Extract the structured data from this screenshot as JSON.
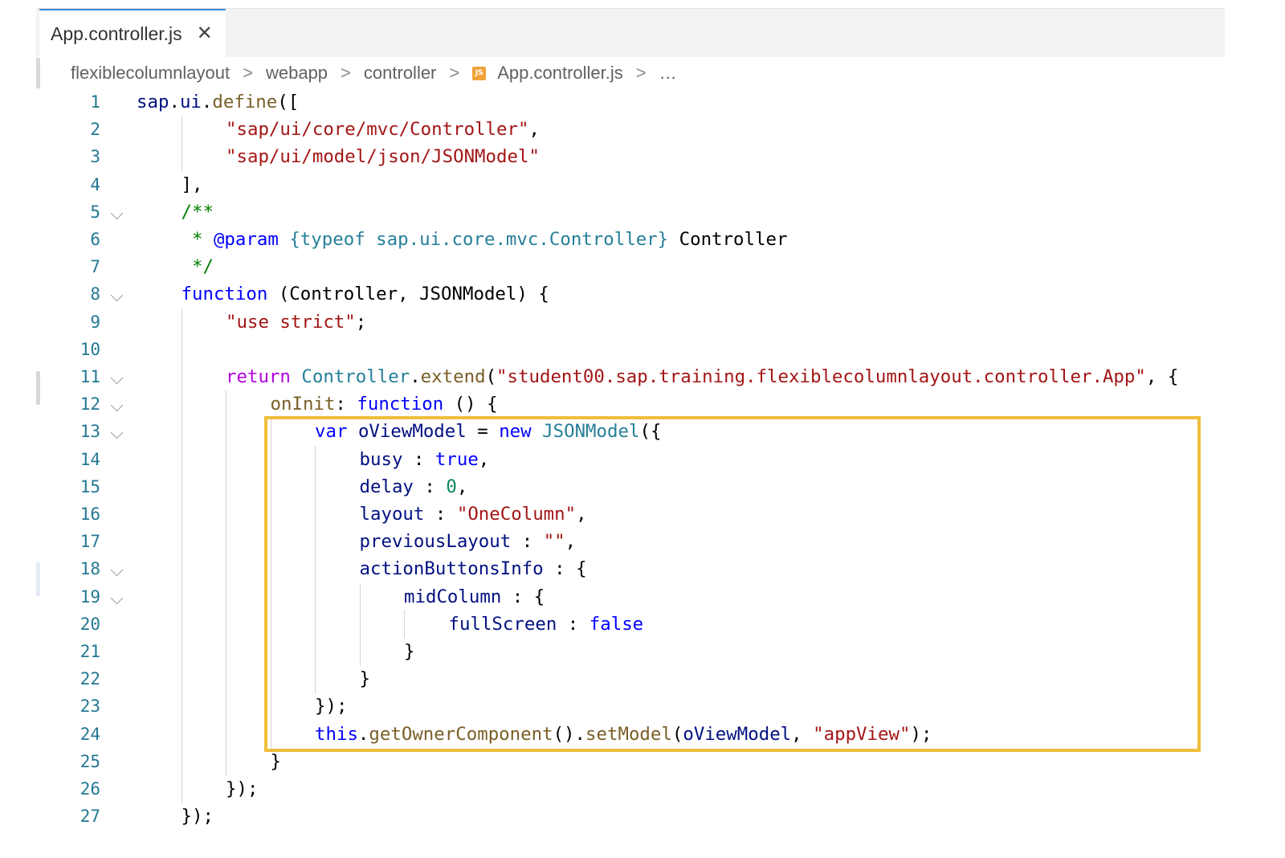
{
  "tab": {
    "title": "App.controller.js",
    "close_glyph": "✕"
  },
  "breadcrumb": {
    "items": [
      "flexiblecolumnlayout",
      "webapp",
      "controller"
    ],
    "file": "App.controller.js",
    "ellipsis": "…",
    "separator": ">",
    "file_badge": "JS"
  },
  "lines": [
    {
      "n": "1",
      "fold": false,
      "indent": 0,
      "tokens": [
        [
          "var",
          "sap"
        ],
        [
          "p",
          "."
        ],
        [
          "var",
          "ui"
        ],
        [
          "p",
          "."
        ],
        [
          "fn",
          "define"
        ],
        [
          "p",
          "(["
        ]
      ]
    },
    {
      "n": "2",
      "fold": false,
      "indent": 2,
      "tokens": [
        [
          "str",
          "\"sap/ui/core/mvc/Controller\""
        ],
        [
          "p",
          ","
        ]
      ]
    },
    {
      "n": "3",
      "fold": false,
      "indent": 2,
      "tokens": [
        [
          "str",
          "\"sap/ui/model/json/JSONModel\""
        ]
      ]
    },
    {
      "n": "4",
      "fold": false,
      "indent": 1,
      "tokens": [
        [
          "p",
          "],"
        ]
      ]
    },
    {
      "n": "5",
      "fold": true,
      "indent": 1,
      "tokens": [
        [
          "cmt",
          "/**"
        ]
      ]
    },
    {
      "n": "6",
      "fold": false,
      "indent": 1,
      "tokens": [
        [
          "cmt",
          " * "
        ],
        [
          "kw",
          "@param"
        ],
        [
          "p",
          " "
        ],
        [
          "cls",
          "{typeof sap.ui.core.mvc.Controller}"
        ],
        [
          "p",
          " Controller"
        ]
      ]
    },
    {
      "n": "7",
      "fold": false,
      "indent": 1,
      "tokens": [
        [
          "cmt",
          " */"
        ]
      ]
    },
    {
      "n": "8",
      "fold": true,
      "indent": 1,
      "tokens": [
        [
          "kw",
          "function"
        ],
        [
          "p",
          " (Controller, JSONModel) {"
        ]
      ]
    },
    {
      "n": "9",
      "fold": false,
      "indent": 2,
      "tokens": [
        [
          "str",
          "\"use strict\""
        ],
        [
          "p",
          ";"
        ]
      ]
    },
    {
      "n": "10",
      "fold": false,
      "indent": 2,
      "tokens": []
    },
    {
      "n": "11",
      "fold": true,
      "indent": 2,
      "tokens": [
        [
          "ctrl",
          "return"
        ],
        [
          "p",
          " "
        ],
        [
          "type",
          "Controller"
        ],
        [
          "p",
          "."
        ],
        [
          "fn",
          "extend"
        ],
        [
          "p",
          "("
        ],
        [
          "str",
          "\"student00.sap.training.flexiblecolumnlayout.controller.App\""
        ],
        [
          "p",
          ", {"
        ]
      ]
    },
    {
      "n": "12",
      "fold": true,
      "indent": 3,
      "tokens": [
        [
          "fn",
          "onInit"
        ],
        [
          "p",
          ": "
        ],
        [
          "kw",
          "function"
        ],
        [
          "p",
          " () {"
        ]
      ]
    },
    {
      "n": "13",
      "fold": true,
      "indent": 4,
      "tokens": [
        [
          "kw",
          "var"
        ],
        [
          "p",
          " "
        ],
        [
          "var",
          "oViewModel"
        ],
        [
          "p",
          " = "
        ],
        [
          "kw",
          "new"
        ],
        [
          "p",
          " "
        ],
        [
          "type",
          "JSONModel"
        ],
        [
          "p",
          "({"
        ]
      ]
    },
    {
      "n": "14",
      "fold": false,
      "indent": 5,
      "tokens": [
        [
          "var",
          "busy"
        ],
        [
          "p",
          " : "
        ],
        [
          "kw",
          "true"
        ],
        [
          "p",
          ","
        ]
      ]
    },
    {
      "n": "15",
      "fold": false,
      "indent": 5,
      "tokens": [
        [
          "var",
          "delay"
        ],
        [
          "p",
          " : "
        ],
        [
          "num",
          "0"
        ],
        [
          "p",
          ","
        ]
      ]
    },
    {
      "n": "16",
      "fold": false,
      "indent": 5,
      "tokens": [
        [
          "var",
          "layout"
        ],
        [
          "p",
          " : "
        ],
        [
          "str",
          "\"OneColumn\""
        ],
        [
          "p",
          ","
        ]
      ]
    },
    {
      "n": "17",
      "fold": false,
      "indent": 5,
      "tokens": [
        [
          "var",
          "previousLayout"
        ],
        [
          "p",
          " : "
        ],
        [
          "str",
          "\"\""
        ],
        [
          "p",
          ","
        ]
      ]
    },
    {
      "n": "18",
      "fold": true,
      "indent": 5,
      "tokens": [
        [
          "var",
          "actionButtonsInfo"
        ],
        [
          "p",
          " : {"
        ]
      ]
    },
    {
      "n": "19",
      "fold": true,
      "indent": 6,
      "tokens": [
        [
          "var",
          "midColumn"
        ],
        [
          "p",
          " : {"
        ]
      ]
    },
    {
      "n": "20",
      "fold": false,
      "indent": 7,
      "tokens": [
        [
          "var",
          "fullScreen"
        ],
        [
          "p",
          " : "
        ],
        [
          "kw",
          "false"
        ]
      ]
    },
    {
      "n": "21",
      "fold": false,
      "indent": 6,
      "tokens": [
        [
          "p",
          "}"
        ]
      ]
    },
    {
      "n": "22",
      "fold": false,
      "indent": 5,
      "tokens": [
        [
          "p",
          "}"
        ]
      ]
    },
    {
      "n": "23",
      "fold": false,
      "indent": 4,
      "tokens": [
        [
          "p",
          "});"
        ]
      ]
    },
    {
      "n": "24",
      "fold": false,
      "indent": 4,
      "tokens": [
        [
          "kw",
          "this"
        ],
        [
          "p",
          "."
        ],
        [
          "fn",
          "getOwnerComponent"
        ],
        [
          "p",
          "()."
        ],
        [
          "fn",
          "setModel"
        ],
        [
          "p",
          "("
        ],
        [
          "var",
          "oViewModel"
        ],
        [
          "p",
          ", "
        ],
        [
          "str",
          "\"appView\""
        ],
        [
          "p",
          ");"
        ]
      ]
    },
    {
      "n": "25",
      "fold": false,
      "indent": 3,
      "tokens": [
        [
          "p",
          "}"
        ]
      ]
    },
    {
      "n": "26",
      "fold": false,
      "indent": 2,
      "tokens": [
        [
          "p",
          "});"
        ]
      ]
    },
    {
      "n": "27",
      "fold": false,
      "indent": 1,
      "tokens": [
        [
          "p",
          "});"
        ]
      ]
    }
  ],
  "colors": {
    "string": "#a31515",
    "keyword": "#0000ff",
    "control": "#af00db",
    "function": "#795e26",
    "variable": "#001080",
    "comment": "#008000",
    "type": "#267f99",
    "number": "#098658",
    "line_number": "#237893",
    "highlight_box": "#f0be3c",
    "active_tab_border": "#3c88d4"
  }
}
